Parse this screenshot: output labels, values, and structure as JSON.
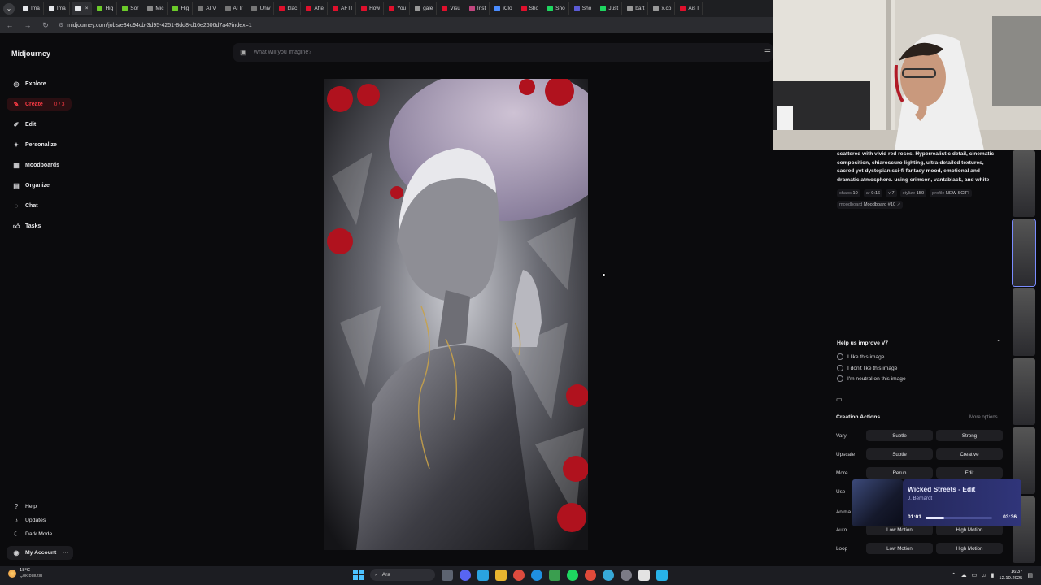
{
  "browser": {
    "tabs": [
      "Ima",
      "Ima",
      "",
      "Hig",
      "Sor",
      "Mic",
      "Hig",
      "AI V",
      "AI Ir",
      "Univ",
      "blac",
      "Afte",
      "AFTI",
      "How",
      "You",
      "gale",
      "Visu",
      "Inst",
      "iClo",
      "Sho",
      "Sho",
      "Sho",
      "Just",
      "bart",
      "x.co",
      "Ais I"
    ],
    "url": "midjourney.com/jobs/e34c94cb-3d95-4251-8dd8-d16e2606d7a4?index=1"
  },
  "sidebar": {
    "logo": "Midjourney",
    "items": [
      {
        "label": "Explore",
        "icon": "compass-icon"
      },
      {
        "label": "Create",
        "icon": "brush-icon",
        "count": "0 / 3"
      },
      {
        "label": "Edit",
        "icon": "edit-icon"
      },
      {
        "label": "Personalize",
        "icon": "personalize-icon"
      },
      {
        "label": "Moodboards",
        "icon": "moodboard-icon"
      },
      {
        "label": "Organize",
        "icon": "grid-icon"
      },
      {
        "label": "Chat",
        "icon": "chat-icon"
      },
      {
        "label": "Tasks",
        "icon": "thumbs-up-icon"
      }
    ],
    "footer": {
      "help": "Help",
      "updates": "Updates",
      "dark_mode": "Dark Mode",
      "account": "My Account"
    }
  },
  "prompt_bar": {
    "placeholder": "What will you imagine?"
  },
  "details": {
    "prompt_text": "scattered with vivid red roses. Hyperrealistic detail, cinematic composition, chiaroscuro lighting, ultra-detailed textures, sacred yet dystopian sci-fi fantasy mood, emotional and dramatic atmosphere. using crimson, vantablack, and white",
    "params": [
      {
        "k": "chaos",
        "v": "10"
      },
      {
        "k": "ar",
        "v": "9:16"
      },
      {
        "k": "v",
        "v": "7"
      },
      {
        "k": "stylize",
        "v": "150"
      },
      {
        "k": "profile",
        "v": "NEW SCIFI"
      },
      {
        "k": "moodboard",
        "v": "Moodboard #10"
      }
    ]
  },
  "feedback": {
    "title": "Help us improve V7",
    "options": [
      "I like this image",
      "I don't like this image",
      "I'm neutral on this image"
    ]
  },
  "creation_actions": {
    "title": "Creation Actions",
    "more": "More options",
    "rows": [
      {
        "label": "Vary",
        "buttons": [
          "Subtle",
          "Strong"
        ]
      },
      {
        "label": "Upscale",
        "buttons": [
          "Subtle",
          "Creative"
        ]
      },
      {
        "label": "More",
        "buttons": [
          "Rerun",
          "Edit"
        ]
      },
      {
        "label": "Use",
        "buttons": []
      },
      {
        "label": "Anima",
        "buttons": []
      },
      {
        "label": "Auto",
        "buttons": [
          "Low Motion",
          "High Motion"
        ]
      },
      {
        "label": "Loop",
        "buttons": [
          "Low Motion",
          "High Motion"
        ]
      }
    ]
  },
  "music": {
    "song": "Wicked Streets - Edit",
    "artist": "J. Bernardt",
    "elapsed": "01:01",
    "duration": "03:36",
    "progress": 0.28
  },
  "taskbar": {
    "temp": "18°C",
    "condition": "Çok bulutlu",
    "search": "Ara",
    "time": "16:37",
    "date": "12.10.2025"
  },
  "colors": {
    "accent": "#ff3b45",
    "background": "#0b0b0d",
    "music_card": "#2a2f6e"
  }
}
